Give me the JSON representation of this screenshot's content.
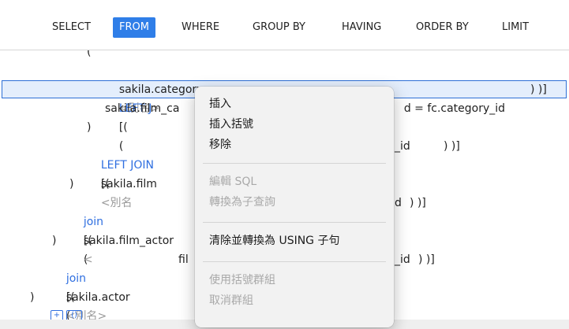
{
  "tabs": [
    "SELECT",
    "FROM",
    "WHERE",
    "GROUP BY",
    "HAVING",
    "ORDER BY",
    "LIMIT"
  ],
  "active_tab": "FROM",
  "code": {
    "l0": "(",
    "l1_name": "sakila.category",
    "l1_alias": "<別名>",
    "l2_kw": "LEFT J",
    "l2_br": "[(",
    "l2_p": "(",
    "l2_tail": "d = fc.category_id",
    "l2_end": ") )]",
    "l3_name": "sakila.film_ca",
    "l4": ")",
    "l5_kw": "LEFT JOIN",
    "l5_br": "[(",
    "l5_tail": "_id",
    "l5_end": ") )]",
    "l6_name": "sakila.film",
    "l6_alias": "<別名",
    "l7": ")",
    "l8_kw": "join",
    "l8_br": "[(",
    "l8_p": "(",
    "l8_tail": "d",
    "l8_end": ") )]",
    "l9_name": "sakila.film_actor",
    "l9_alias": "<",
    "l10": ")",
    "l11_kw": "join",
    "l11_br": "[(",
    "l11_p": "(",
    "l11_mid": "fil",
    "l11_tail": "_id",
    "l11_end": ") )]",
    "l12_name": "sakila.actor",
    "l12_alias": "<別名>",
    "l13_a": ")",
    "l13_b": "+",
    "l13_c": "()"
  },
  "context_menu": {
    "insert": "插入",
    "insert_parens": "插入括號",
    "remove": "移除",
    "edit_sql": "編輯 SQL",
    "to_subquery": "轉換為子查詢",
    "clear_to_using": "清除並轉換為 USING 子句",
    "group_with_parens": "使用括號群組",
    "ungroup": "取消群組"
  },
  "colors": {
    "accent": "#2f7ee8",
    "keyword": "#2f6fe0",
    "alias": "#9a9a9a",
    "selection_bg": "#e4eefc",
    "selection_border": "#2d6fd6",
    "menu_bg": "#f2f2f2",
    "disabled_text": "#a9a9a9"
  }
}
